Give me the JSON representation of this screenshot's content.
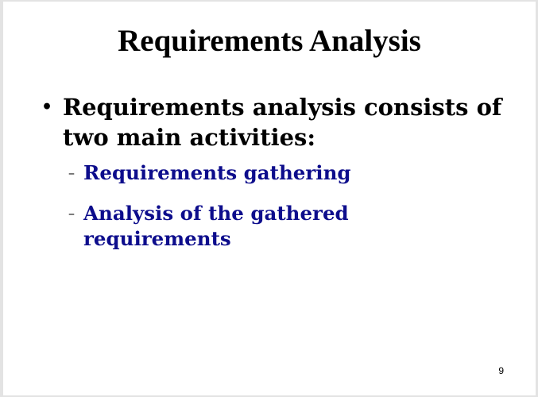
{
  "slide": {
    "title": "Requirements Analysis",
    "bullet": {
      "marker": "•",
      "text": "Requirements analysis consists of two main activities:"
    },
    "sub_items": [
      {
        "marker": "–",
        "text": "Requirements gathering"
      },
      {
        "marker": "–",
        "text": "Analysis of the gathered requirements"
      }
    ],
    "page_number": "9"
  },
  "colors": {
    "sub_item_text": "#0d0d8c",
    "main_text": "#000000",
    "background": "#ffffff"
  }
}
